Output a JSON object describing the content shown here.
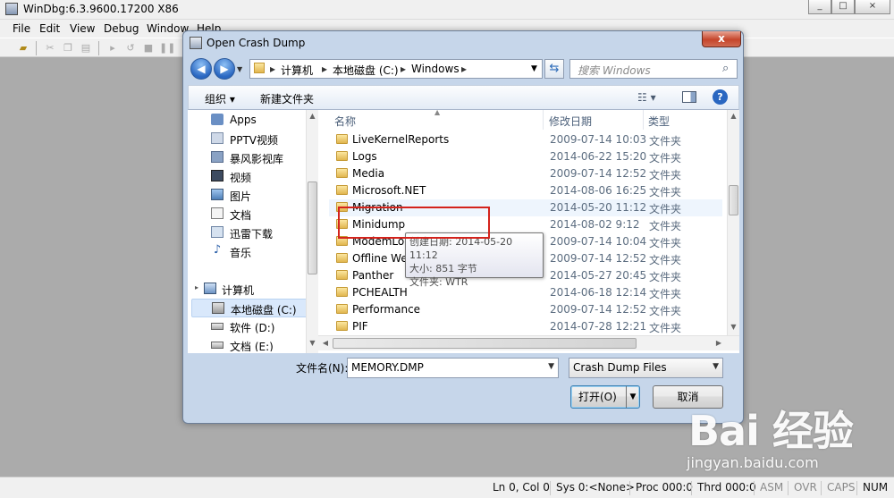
{
  "app": {
    "title": "WinDbg:6.3.9600.17200 X86",
    "window_buttons": [
      "_",
      "□",
      "×"
    ]
  },
  "menu": [
    "File",
    "Edit",
    "View",
    "Debug",
    "Window",
    "Help"
  ],
  "status_bar": {
    "line_col": "Ln 0, Col 0",
    "sys": "Sys 0:<None>",
    "proc": "Proc 000:0",
    "thrd": "Thrd 000:0",
    "asm": "ASM",
    "ovr": "OVR",
    "caps": "CAPS",
    "num": "NUM"
  },
  "dialog": {
    "title": "Open Crash Dump",
    "close_label": "x",
    "breadcrumb": [
      "计算机",
      "本地磁盘 (C:)",
      "Windows"
    ],
    "search_placeholder": "搜索 Windows",
    "organize_label": "组织 ▾",
    "new_folder_label": "新建文件夹",
    "nav_items": [
      {
        "label": "Apps"
      },
      {
        "label": "PPTV视频"
      },
      {
        "label": "暴风影视库"
      },
      {
        "label": "视频"
      },
      {
        "label": "图片"
      },
      {
        "label": "文档"
      },
      {
        "label": "迅雷下载"
      },
      {
        "label": "音乐"
      },
      {
        "label": "计算机"
      },
      {
        "label": "本地磁盘 (C:)"
      },
      {
        "label": "软件 (D:)"
      },
      {
        "label": "文档 (E:)"
      }
    ],
    "columns": {
      "name": "名称",
      "date": "修改日期",
      "type": "类型"
    },
    "files": [
      {
        "name": "LiveKernelReports",
        "date": "2009-07-14 10:03",
        "type": "文件夹"
      },
      {
        "name": "Logs",
        "date": "2014-06-22 15:20",
        "type": "文件夹"
      },
      {
        "name": "Media",
        "date": "2009-07-14 12:52",
        "type": "文件夹"
      },
      {
        "name": "Microsoft.NET",
        "date": "2014-08-06 16:25",
        "type": "文件夹"
      },
      {
        "name": "Migration",
        "date": "2014-05-20 11:12",
        "type": "文件夹"
      },
      {
        "name": "Minidump",
        "date": "2014-08-02 9:12",
        "type": "文件夹"
      },
      {
        "name": "ModemLogs",
        "date": "2009-07-14 10:04",
        "type": "文件夹"
      },
      {
        "name": "Offline Web Pages",
        "date": "2009-07-14 12:52",
        "type": "文件夹"
      },
      {
        "name": "Panther",
        "date": "2014-05-27 20:45",
        "type": "文件夹"
      },
      {
        "name": "PCHEALTH",
        "date": "2014-06-18 12:14",
        "type": "文件夹"
      },
      {
        "name": "Performance",
        "date": "2009-07-14 12:52",
        "type": "文件夹"
      },
      {
        "name": "PIF",
        "date": "2014-07-28 12:21",
        "type": "文件夹"
      }
    ],
    "tooltip": {
      "created": "创建日期: 2014-05-20 11:12",
      "size": "大小: 851 字节",
      "folder": "文件夹: WTR"
    },
    "filename_label": "文件名(N):",
    "filename_value": "MEMORY.DMP",
    "filetype_value": "Crash Dump Files",
    "open_label": "打开(O)",
    "cancel_label": "取消"
  },
  "watermark": {
    "logo": "Bai 经验",
    "url": "jingyan.baidu.com"
  },
  "colors": {
    "accent": "#2a67c1",
    "highlight_box": "#d4231c",
    "workspace": "#ababab"
  }
}
